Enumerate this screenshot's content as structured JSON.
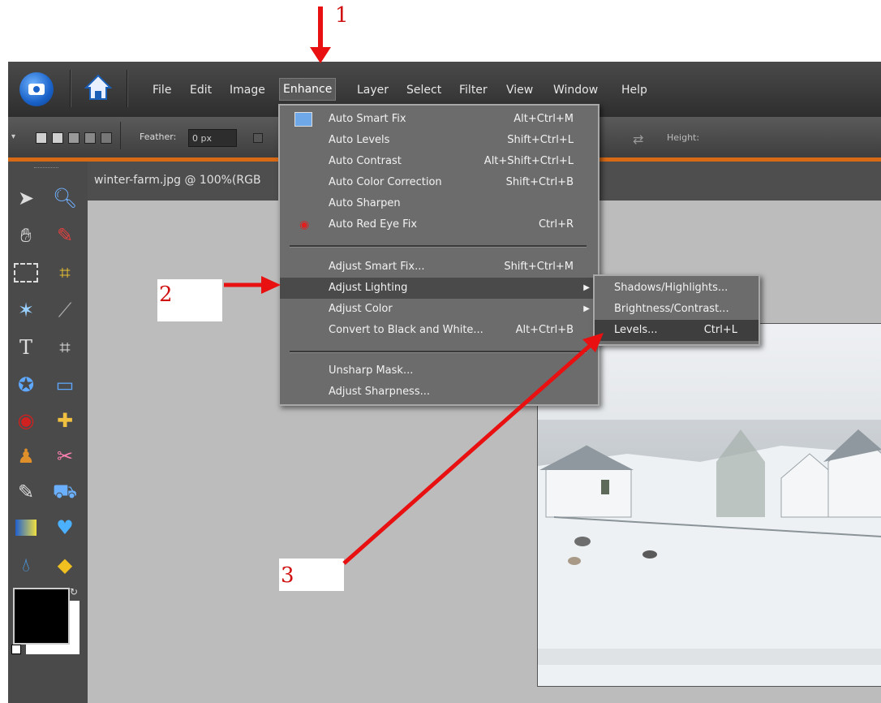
{
  "annotations": {
    "step1": "1",
    "step2": "2",
    "step3": "3"
  },
  "menubar": {
    "items": [
      "File",
      "Edit",
      "Image",
      "Enhance",
      "Layer",
      "Select",
      "Filter",
      "View",
      "Window",
      "Help"
    ],
    "active": "Enhance"
  },
  "options_bar": {
    "feather_label": "Feather:",
    "feather_value": "0 px",
    "height_label": "Height:"
  },
  "document": {
    "title": "winter-farm.jpg @ 100%(RGB"
  },
  "enhance_menu": {
    "items": [
      {
        "label": "Auto Smart Fix",
        "shortcut": "Alt+Ctrl+M",
        "icon": "auto-smart-fix-icon"
      },
      {
        "label": "Auto Levels",
        "shortcut": "Shift+Ctrl+L"
      },
      {
        "label": "Auto Contrast",
        "shortcut": "Alt+Shift+Ctrl+L"
      },
      {
        "label": "Auto Color Correction",
        "shortcut": "Shift+Ctrl+B"
      },
      {
        "label": "Auto Sharpen",
        "shortcut": ""
      },
      {
        "label": "Auto Red Eye Fix",
        "shortcut": "Ctrl+R",
        "icon": "red-eye-icon"
      },
      {
        "label": "Adjust Smart Fix...",
        "shortcut": "Shift+Ctrl+M"
      },
      {
        "label": "Adjust Lighting",
        "shortcut": "",
        "submenu": true
      },
      {
        "label": "Adjust Color",
        "shortcut": "",
        "submenu": true
      },
      {
        "label": "Convert to Black and White...",
        "shortcut": "Alt+Ctrl+B"
      },
      {
        "label": "Unsharp Mask...",
        "shortcut": ""
      },
      {
        "label": "Adjust Sharpness...",
        "shortcut": ""
      }
    ]
  },
  "lighting_submenu": {
    "items": [
      {
        "label": "Shadows/Highlights...",
        "shortcut": ""
      },
      {
        "label": "Brightness/Contrast...",
        "shortcut": ""
      },
      {
        "label": "Levels...",
        "shortcut": "Ctrl+L"
      }
    ]
  },
  "colors": {
    "accent_orange": "#d86a16",
    "annotation_red": "#e81010",
    "menu_bg": "#6c6c6c"
  }
}
